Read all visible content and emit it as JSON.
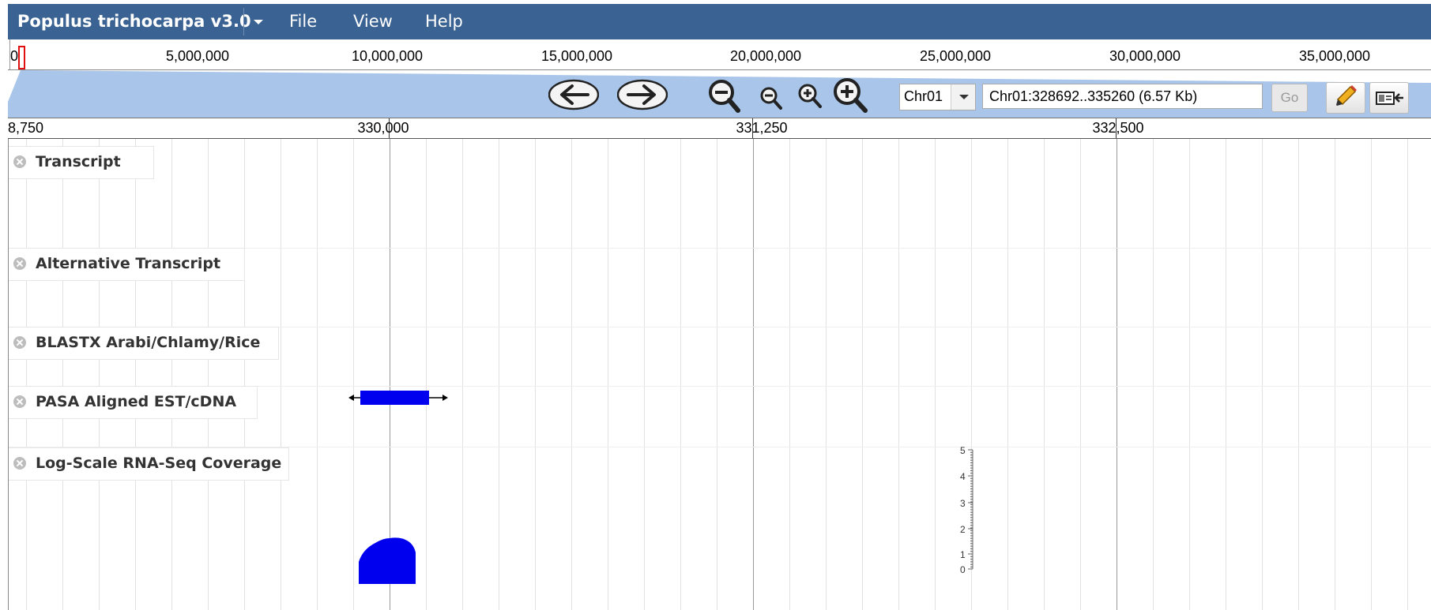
{
  "menubar": {
    "title": "Populus trichocarpa v3.0",
    "items": [
      {
        "label": "File"
      },
      {
        "label": "View"
      },
      {
        "label": "Help"
      }
    ]
  },
  "overview_ruler": {
    "labels": [
      "0",
      "5,000,000",
      "10,000,000",
      "15,000,000",
      "20,000,000",
      "25,000,000",
      "30,000,000",
      "35,000,000"
    ]
  },
  "toolbar": {
    "chromosome": "Chr01",
    "location": "Chr01:328692..335260 (6.57 Kb)",
    "go_label": "Go",
    "icons": [
      "pan-left-icon",
      "pan-right-icon",
      "zoom-out-large-icon",
      "zoom-out-small-icon",
      "zoom-in-small-icon",
      "zoom-in-large-icon",
      "highlight-icon",
      "export-icon"
    ]
  },
  "detail_ruler": {
    "labels": [
      "8,750",
      "330,000",
      "331,250",
      "332,500"
    ]
  },
  "tracks": [
    {
      "label": "Transcript"
    },
    {
      "label": "Alternative Transcript"
    },
    {
      "label": "BLASTX Arabi/Chlamy/Rice"
    },
    {
      "label": "PASA Aligned EST/cDNA"
    },
    {
      "label": "Log-Scale RNA-Seq Coverage"
    }
  ],
  "coverage_axis": {
    "ticks": [
      "5",
      "4",
      "3",
      "2",
      "1",
      "0"
    ]
  },
  "colors": {
    "menubar": "#3a6292",
    "feature": "#0000ee",
    "zoom_band": "#a9c6ea"
  }
}
